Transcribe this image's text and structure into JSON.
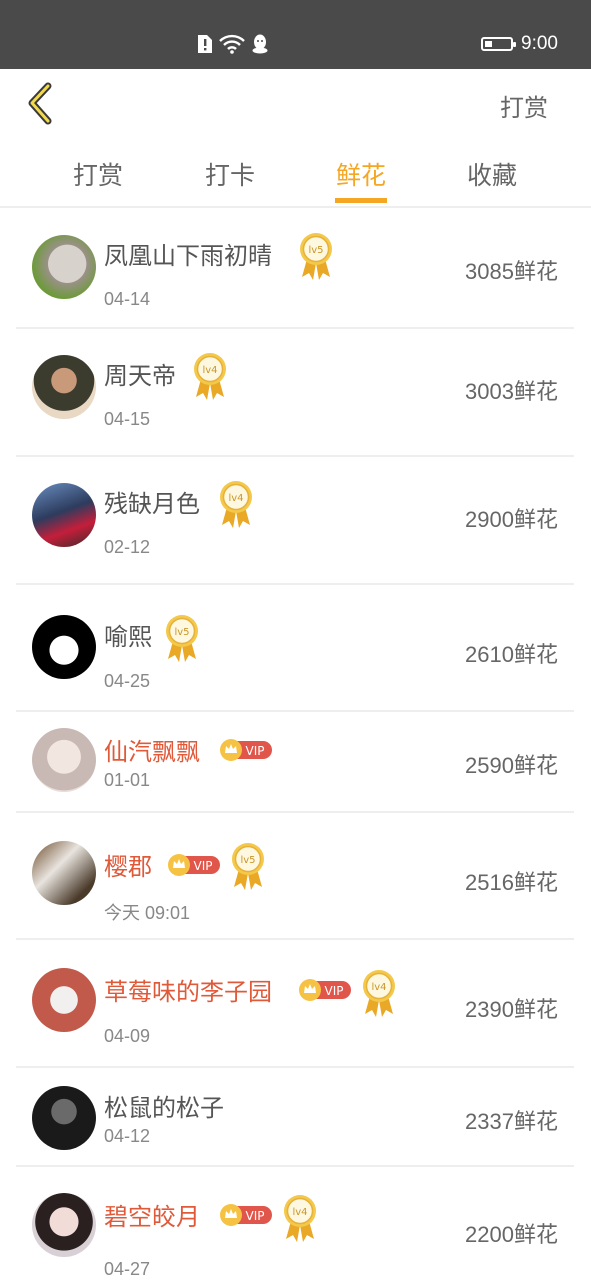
{
  "status_bar": {
    "time": "9:00",
    "battery_level": 0.3,
    "icons": [
      "sim-alert-icon",
      "wifi-icon",
      "qq-icon"
    ]
  },
  "header": {
    "back_icon": "chevron-left-icon",
    "right_action": "打赏"
  },
  "tabs": [
    {
      "label": "打赏",
      "active": false
    },
    {
      "label": "打卡",
      "active": false
    },
    {
      "label": "鲜花",
      "active": true
    },
    {
      "label": "收藏",
      "active": false
    }
  ],
  "colors": {
    "accent": "#f5a623",
    "vip_name": "#e05a3a",
    "vip_badge": "#e0564a"
  },
  "vip_label": "VIP",
  "items": [
    {
      "name": "凤凰山下雨初晴",
      "date": "04-14",
      "amount": "3085鲜花",
      "vip": false,
      "level": "lv5"
    },
    {
      "name": "周天帝",
      "date": "04-15",
      "amount": "3003鲜花",
      "vip": false,
      "level": "lv4"
    },
    {
      "name": "残缺月色",
      "date": "02-12",
      "amount": "2900鲜花",
      "vip": false,
      "level": "lv4"
    },
    {
      "name": "喻熙",
      "date": "04-25",
      "amount": "2610鲜花",
      "vip": false,
      "level": "lv5"
    },
    {
      "name": "仙汽飘飘",
      "date": "01-01",
      "amount": "2590鲜花",
      "vip": true,
      "level": ""
    },
    {
      "name": "樱郡",
      "date": "今天 09:01",
      "amount": "2516鲜花",
      "vip": true,
      "level": "lv5"
    },
    {
      "name": "草莓味的李子园",
      "date": "04-09",
      "amount": "2390鲜花",
      "vip": true,
      "level": "lv4"
    },
    {
      "name": "松鼠的松子",
      "date": "04-12",
      "amount": "2337鲜花",
      "vip": false,
      "level": ""
    },
    {
      "name": "碧空皎月",
      "date": "04-27",
      "amount": "2200鲜花",
      "vip": true,
      "level": "lv4"
    }
  ]
}
